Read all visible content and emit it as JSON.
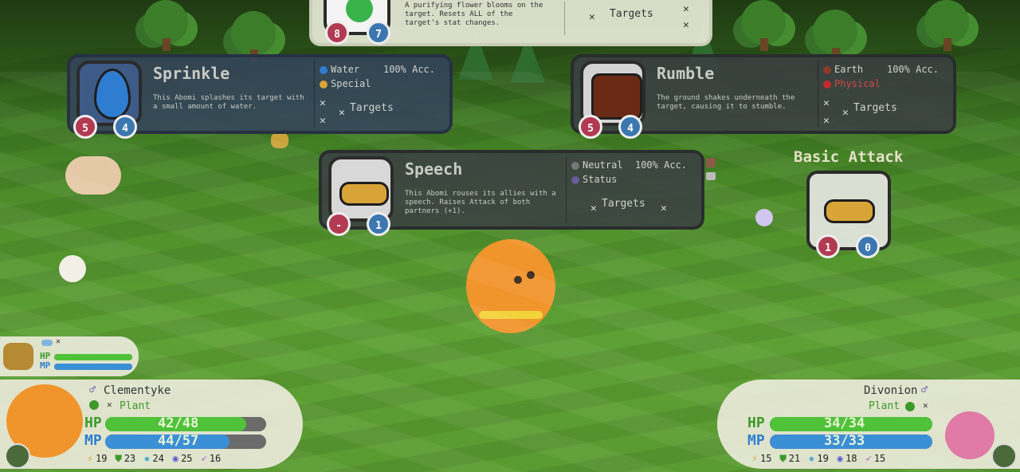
{
  "top_move": {
    "description_line1": "A purifying flower blooms on the",
    "description_line2": "target. Resets ALL of the",
    "description_line3": "target's stat changes.",
    "targets_label": "Targets",
    "cost": "8",
    "priority": "7"
  },
  "moves": [
    {
      "name": "Sprinkle",
      "element": "Water",
      "category": "Special",
      "accuracy": "100% Acc.",
      "description": "This Abomi splashes its target with a small amount of water.",
      "targets_label": "Targets",
      "cost": "5",
      "priority": "4",
      "element_color": "#2f7dd1",
      "category_color": "#d9a437"
    },
    {
      "name": "Rumble",
      "element": "Earth",
      "category": "Physical",
      "accuracy": "100% Acc.",
      "description": "The ground shakes underneath the target, causing it to stumble.",
      "targets_label": "Targets",
      "cost": "5",
      "priority": "4",
      "element_color": "#8b3b2a",
      "category_color": "#c62b2b"
    },
    {
      "name": "Speech",
      "element": "Neutral",
      "category": "Status",
      "accuracy": "100% Acc.",
      "description": "This Abomi rouses its allies with a speech. Raises Attack of both partners (+1).",
      "targets_label": "Targets",
      "cost": "-",
      "priority": "1"
    }
  ],
  "basic_attack": {
    "title": "Basic Attack",
    "cost": "1",
    "priority": "0"
  },
  "player": {
    "name": "Clementyke",
    "type": "Plant",
    "hp_label": "HP",
    "mp_label": "MP",
    "hp": "42/48",
    "mp": "44/57",
    "hp_fraction": 0.875,
    "mp_fraction": 0.772,
    "stats": [
      "19",
      "23",
      "24",
      "25",
      "16"
    ]
  },
  "enemy": {
    "name": "Divonion",
    "type": "Plant",
    "hp_label": "HP",
    "mp_label": "MP",
    "hp": "34/34",
    "mp": "33/33",
    "hp_fraction": 1.0,
    "mp_fraction": 1.0,
    "stats": [
      "15",
      "21",
      "19",
      "18",
      "15"
    ]
  },
  "partner": {
    "hp_label": "HP",
    "mp_label": "MP",
    "hp_fraction": 1.0,
    "mp_fraction": 1.0
  },
  "colors": {
    "hp_fill": "#4fc23a",
    "mp_fill": "#3a8fd6",
    "badge_red": "#b23a52",
    "badge_blue": "#3c77b0"
  }
}
